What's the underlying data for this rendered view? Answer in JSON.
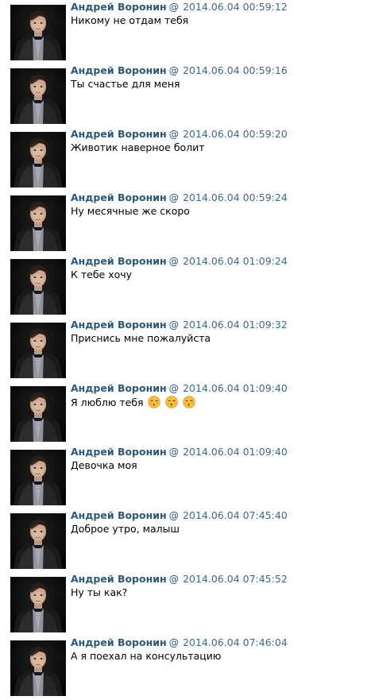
{
  "messages": [
    {
      "author": "Андрей Воронин",
      "at": "@",
      "date": "2014.06.04 00:59:12",
      "text": "Никому не отдам тебя",
      "emojis": []
    },
    {
      "author": "Андрей Воронин",
      "at": "@",
      "date": "2014.06.04 00:59:16",
      "text": "Ты счастье для меня",
      "emojis": []
    },
    {
      "author": "Андрей Воронин",
      "at": "@",
      "date": "2014.06.04 00:59:20",
      "text": "Животик наверное болит",
      "emojis": []
    },
    {
      "author": "Андрей Воронин",
      "at": "@",
      "date": "2014.06.04 00:59:24",
      "text": "Ну месячные же скоро",
      "emojis": []
    },
    {
      "author": "Андрей Воронин",
      "at": "@",
      "date": "2014.06.04 01:09:24",
      "text": "К тебе хочу",
      "emojis": []
    },
    {
      "author": "Андрей Воронин",
      "at": "@",
      "date": "2014.06.04 01:09:32",
      "text": "Приснись мне пожалуйста",
      "emojis": []
    },
    {
      "author": "Андрей Воронин",
      "at": "@",
      "date": "2014.06.04 01:09:40",
      "text": "Я люблю тебя",
      "emojis": [
        "kissing-face-emoji",
        "kissing-face-emoji",
        "kissing-face-emoji"
      ]
    },
    {
      "author": "Андрей Воронин",
      "at": "@",
      "date": "2014.06.04 01:09:40",
      "text": "Девочка моя",
      "emojis": []
    },
    {
      "author": "Андрей Воронин",
      "at": "@",
      "date": "2014.06.04 07:45:40",
      "text": "Доброе утро, малыш",
      "emojis": []
    },
    {
      "author": "Андрей Воронин",
      "at": "@",
      "date": "2014.06.04 07:45:52",
      "text": "Ну ты как?",
      "emojis": []
    },
    {
      "author": "Андрей Воронин",
      "at": "@",
      "date": "2014.06.04 07:46:04",
      "text": "А я поехал на консультацию",
      "emojis": []
    }
  ],
  "colors": {
    "author": "#2b587a",
    "date": "#3b6a8f",
    "text": "#000000",
    "background": "#ffffff"
  }
}
